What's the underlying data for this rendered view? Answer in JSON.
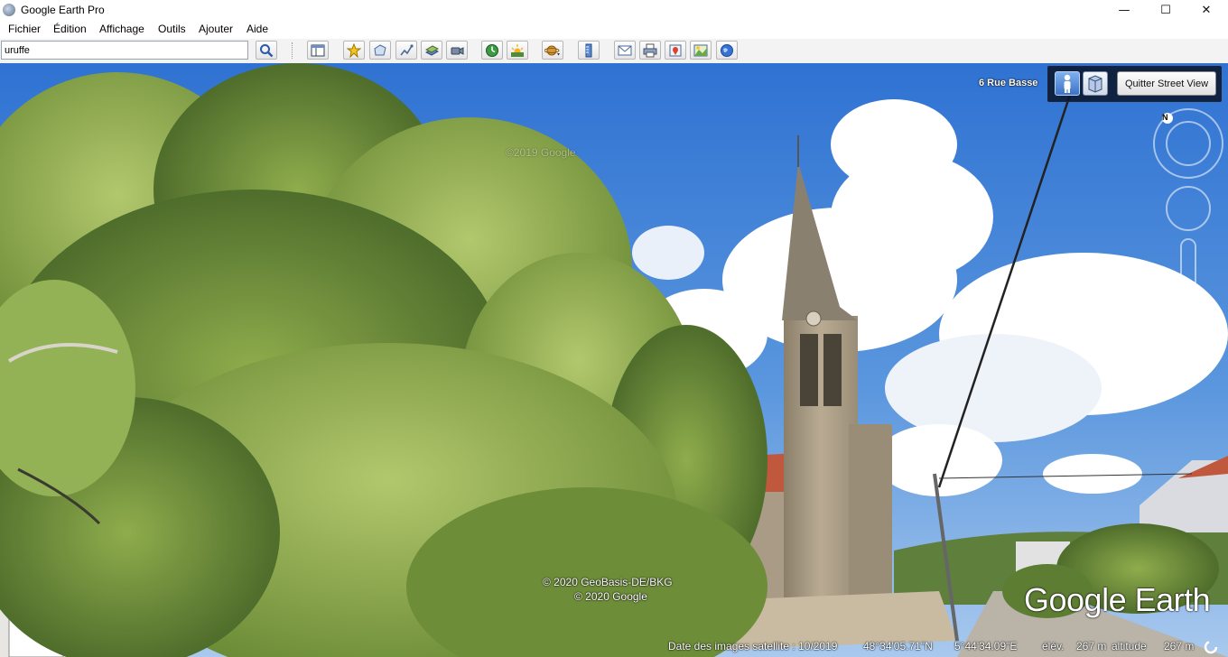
{
  "window": {
    "title": "Google Earth Pro",
    "controls": {
      "minimize": "—",
      "maximize": "☐",
      "close": "✕"
    }
  },
  "menu": [
    {
      "label": "Fichier"
    },
    {
      "label": "Édition"
    },
    {
      "label": "Affichage"
    },
    {
      "label": "Outils"
    },
    {
      "label": "Ajouter"
    },
    {
      "label": "Aide"
    }
  ],
  "search": {
    "value": "uruffe"
  },
  "toolbar": {
    "buttons": [
      "search-icon",
      "sidebar-toggle-icon",
      "placemark-icon",
      "polygon-icon",
      "path-icon",
      "image-overlay-icon",
      "record-tour-icon",
      "historical-imagery-icon",
      "sunlight-icon",
      "planets-icon",
      "ruler-icon",
      "email-icon",
      "print-icon",
      "save-image-icon",
      "view-in-maps-icon",
      "earth-icon"
    ]
  },
  "streetview": {
    "address": "6 Rue Basse",
    "quit_label": "Quitter Street View",
    "compass_letter": "N"
  },
  "watermarks": {
    "copyright_top": "©2019 Google",
    "copyright_line1": "© 2020 GeoBasis-DE/BKG",
    "copyright_line2": "© 2020 Google",
    "brand": "Google Earth"
  },
  "status": {
    "imagery_date": "Date des images satellite : 10/2019",
    "latitude": "48°34'05.71\"N",
    "longitude": "5°44'34.09\"E",
    "elevation_label": "élév.",
    "elevation": "267 m",
    "altitude_label": "altitude",
    "altitude": "267 m"
  },
  "colors": {
    "sky": "#3f7fd0",
    "foliage": "#6f8f3a",
    "church_stone": "#a99b85",
    "roof": "#c0583e"
  }
}
